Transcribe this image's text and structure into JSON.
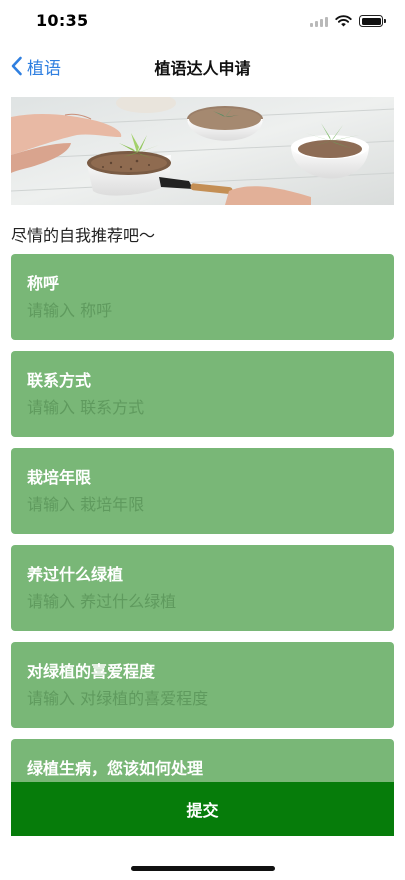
{
  "status_bar": {
    "time": "10:35"
  },
  "nav": {
    "back_label": "植语",
    "title": "植语达人申请"
  },
  "intro_text": "尽情的自我推荐吧～",
  "form": {
    "fields": [
      {
        "label": "称呼",
        "placeholder": "请输入 称呼"
      },
      {
        "label": "联系方式",
        "placeholder": "请输入 联系方式"
      },
      {
        "label": "栽培年限",
        "placeholder": "请输入 栽培年限"
      },
      {
        "label": "养过什么绿植",
        "placeholder": "请输入 养过什么绿植"
      },
      {
        "label": "对绿植的喜爱程度",
        "placeholder": "请输入 对绿植的喜爱程度"
      },
      {
        "label": "绿植生病，您该如何处理",
        "placeholder": ""
      }
    ]
  },
  "submit_label": "提交",
  "colors": {
    "accent_green": "#79b777",
    "submit_green": "#067c0a",
    "link_blue": "#2f7fe0",
    "placeholder_green": "#5f9a5e"
  },
  "icons": {
    "back": "chevron-left-icon",
    "signal": "cellular-signal-icon",
    "wifi": "wifi-icon",
    "battery": "battery-icon"
  }
}
